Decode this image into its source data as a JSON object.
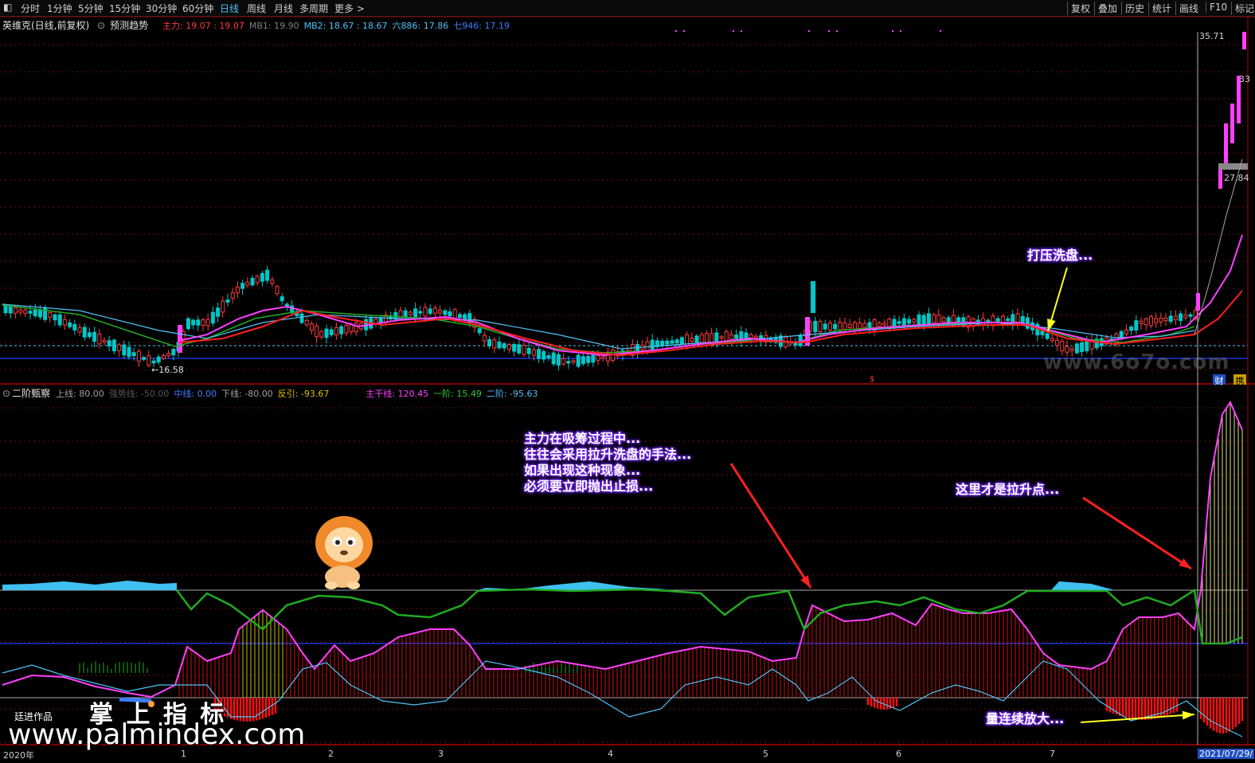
{
  "toolbar": {
    "toggle_icon": "panel-toggle-icon",
    "periods": [
      "分时",
      "1分钟",
      "5分钟",
      "15分钟",
      "30分钟",
      "60分钟",
      "日线",
      "周线",
      "月线",
      "多周期",
      "更多 >"
    ],
    "active_period": "日线",
    "right_buttons": [
      "复权",
      "叠加",
      "历史",
      "统计",
      "画线",
      "F10",
      "标记"
    ]
  },
  "main_panel": {
    "title": "英维克(日线,前复权)",
    "indicator": "预测趋势",
    "legend": [
      {
        "label": "主力: 19.07 : 19.07",
        "color": "#ff3b3b"
      },
      {
        "label": "MB1: 19.90",
        "color": "#808080"
      },
      {
        "label": "MB2: 18.67 : 18.67",
        "color": "#4fc3f7"
      },
      {
        "label": "六886: 17.86",
        "color": "#4fc3f7"
      },
      {
        "label": "七946: 17.19",
        "color": "#3d7dff"
      }
    ],
    "price_labels": {
      "high": "35.71",
      "mid": "33",
      "low": "27.84",
      "min": "16.58"
    },
    "badges": [
      "财",
      "携"
    ],
    "watermark": "www.6o7o.com",
    "callout": "打压洗盘..."
  },
  "sub_panel": {
    "title": "二阶甄察",
    "legend": [
      {
        "label": "上线: 80.00",
        "color": "#a0a0a0"
      },
      {
        "label": "强势线: -50.00",
        "color": "#555555"
      },
      {
        "label": "中线: 0.00",
        "color": "#3d7dff"
      },
      {
        "label": "下线: -80.00",
        "color": "#a0a0a0"
      },
      {
        "label": "反引: -93.67",
        "color": "#e0c000"
      },
      {
        "label": "主干线: 120.45",
        "color": "#ff40ff"
      },
      {
        "label": "一阶: 15.49",
        "color": "#33cc33"
      },
      {
        "label": "二阶: -95.63",
        "color": "#4fc3f7"
      }
    ],
    "callouts": {
      "absorb": [
        "主力在吸筹过程中...",
        "往往会采用拉升洗盘的手法...",
        "如果出现这种现象...",
        "必须要立即抛出止损..."
      ],
      "rise": "这里才是拉升点...",
      "volume": "量连续放大..."
    },
    "mascot": "lion-mascot-icon",
    "author": "廷进作品",
    "brand": "掌 上 指 标",
    "site": "www.palmindex.com"
  },
  "x_axis": {
    "labels": [
      "2020年",
      "1",
      "2",
      "3",
      "4",
      "5",
      "6",
      "7"
    ],
    "cursor_date": "2021/07/29/"
  },
  "chart_data": {
    "type": "line",
    "title": "英维克(日线,前复权)",
    "price_axis_labels": [
      35.71,
      33,
      27.84
    ],
    "lowest_price_label": 16.58,
    "series": [
      {
        "name": "主力",
        "last": 19.07,
        "color": "#ff3b3b"
      },
      {
        "name": "MB1",
        "last": 19.9,
        "color": "#808080"
      },
      {
        "name": "MB2",
        "last": 18.67,
        "color": "#4fc3f7"
      },
      {
        "name": "六886",
        "last": 17.86,
        "color": "#4fc3f7"
      },
      {
        "name": "七946",
        "last": 17.19,
        "color": "#3d7dff"
      },
      {
        "name": "主干线",
        "last": 120.45,
        "color": "#ff40ff"
      },
      {
        "name": "一阶",
        "last": 15.49,
        "color": "#33cc33"
      },
      {
        "name": "二阶",
        "last": -95.63,
        "color": "#4fc3f7"
      }
    ],
    "reference_lines": {
      "上线": 80,
      "中线": 0,
      "下线": -80
    },
    "x_ticks": [
      "2020年",
      "1",
      "2",
      "3",
      "4",
      "5",
      "6",
      "7",
      "2021/07/29/"
    ]
  }
}
